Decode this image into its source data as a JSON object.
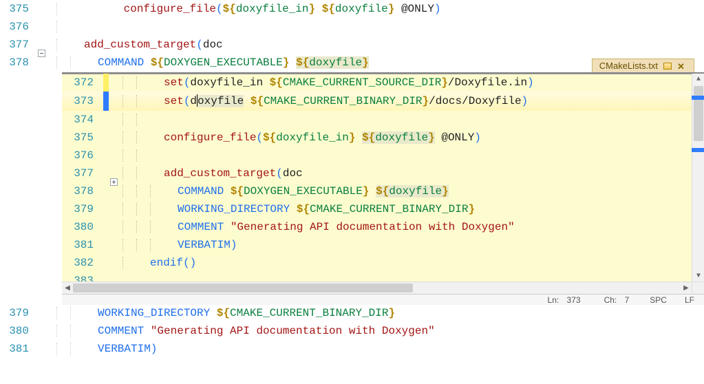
{
  "outer": {
    "lines": {
      "375": {
        "tokens": [
          "configure_file",
          "(",
          "${doxyfile_in}",
          " ",
          "${doxyfile}",
          " @ONLY",
          ")"
        ]
      },
      "376": {
        "tokens": []
      },
      "377": {
        "fold": true,
        "tokens": [
          "add_custom_target",
          "(",
          "doc"
        ]
      },
      "378": {
        "tokens": [
          "COMMAND ",
          "${DOXYGEN_EXECUTABLE}",
          " ",
          "${doxyfile}"
        ],
        "hl_var": "doxyfile"
      },
      "379": {
        "tokens": [
          "WORKING_DIRECTORY ",
          "${CMAKE_CURRENT_BINARY_DIR}"
        ]
      },
      "380": {
        "tokens": [
          "COMMENT ",
          "\"Generating API documentation with Doxygen\""
        ]
      },
      "381": {
        "tokens": [
          "VERBATIM",
          ")"
        ]
      }
    }
  },
  "inner": {
    "tab_title": "CMakeLists.txt",
    "lines": {
      "372": {
        "change": "y",
        "tokens": [
          "set",
          "(",
          "doxyfile_in ",
          "${CMAKE_CURRENT_SOURCE_DIR}",
          "/Doxyfile.in",
          ")"
        ]
      },
      "373": {
        "change": "b",
        "current": true,
        "caret_after": "d",
        "tokens": [
          "set",
          "(",
          "doxyfile ",
          "${CMAKE_CURRENT_BINARY_DIR}",
          "/docs/Doxyfile",
          ")"
        ],
        "hl_var": "doxyfile"
      },
      "374": {
        "tokens": []
      },
      "375": {
        "tokens": [
          "configure_file",
          "(",
          "${doxyfile_in}",
          " ",
          "${doxyfile}",
          " @ONLY",
          ")"
        ],
        "hl_var": "doxyfile"
      },
      "376": {
        "tokens": []
      },
      "377": {
        "fold": true,
        "tokens": [
          "add_custom_target",
          "(",
          "doc"
        ]
      },
      "378": {
        "tokens": [
          "COMMAND ",
          "${DOXYGEN_EXECUTABLE}",
          " ",
          "${doxyfile}"
        ],
        "hl_var": "doxyfile"
      },
      "379": {
        "tokens": [
          "WORKING_DIRECTORY ",
          "${CMAKE_CURRENT_BINARY_DIR}"
        ]
      },
      "380": {
        "tokens": [
          "COMMENT ",
          "\"Generating API documentation with Doxygen\""
        ]
      },
      "381": {
        "tokens": [
          "VERBATIM",
          ")"
        ]
      },
      "382": {
        "outdent": true,
        "tokens": [
          "endif",
          "()"
        ]
      },
      "383": {
        "tokens": []
      }
    },
    "status": {
      "ln_label": "Ln:",
      "ln_value": "373",
      "ch_label": "Ch:",
      "ch_value": "7",
      "insert_mode": "SPC",
      "eol": "LF"
    }
  }
}
